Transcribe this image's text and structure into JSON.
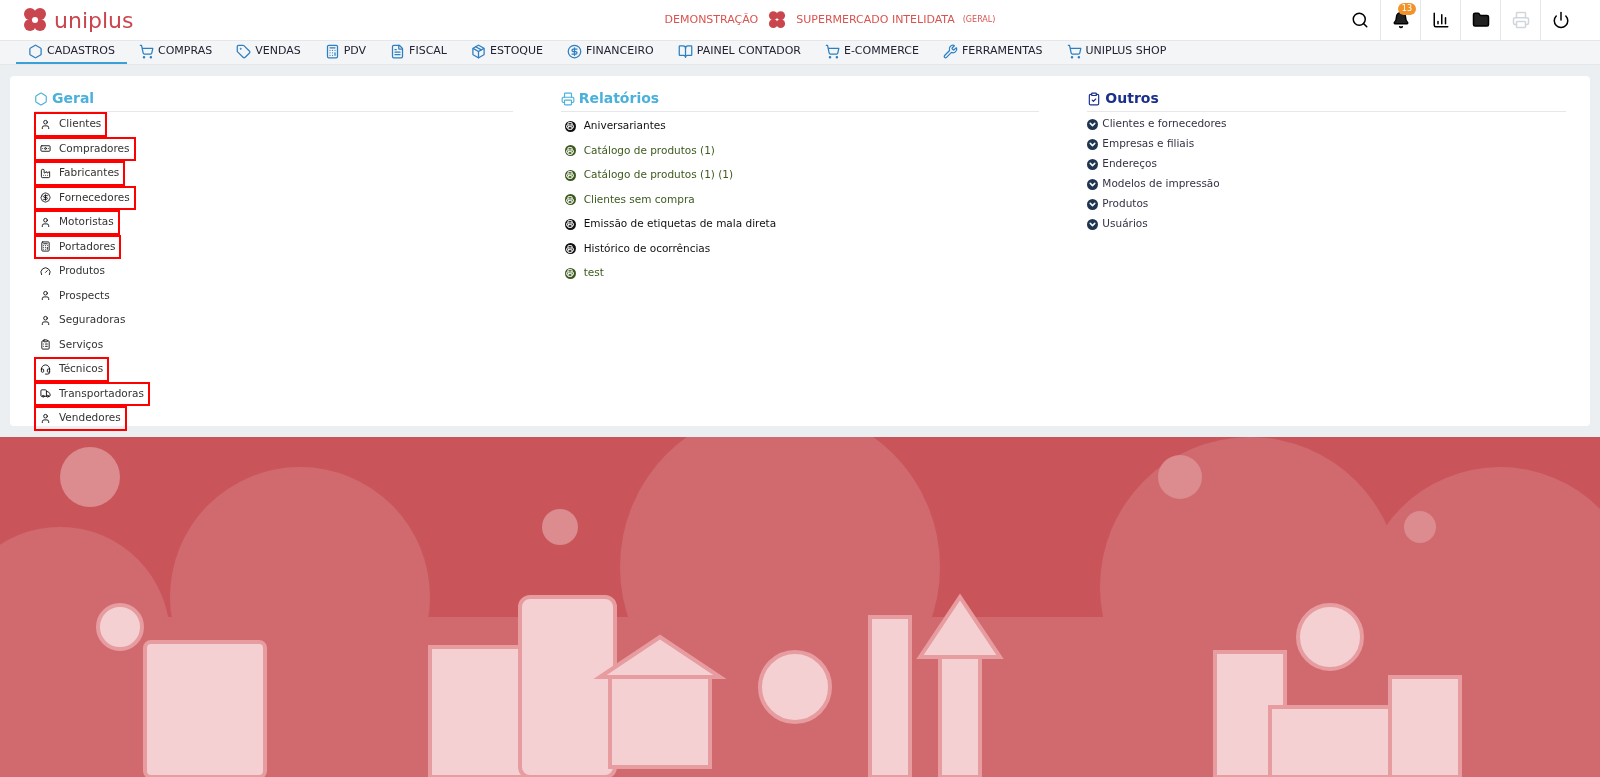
{
  "header": {
    "logo": "uniplus",
    "mode": "DEMONSTRAÇÃO",
    "company": "SUPERMERCADO INTELIDATA",
    "company_scope": "(GERAL)",
    "notifications": "13",
    "print_disabled": true
  },
  "nav": [
    {
      "label": "CADASTROS",
      "selected": true,
      "kind": "hexagon"
    },
    {
      "label": "COMPRAS",
      "selected": false,
      "kind": "cart"
    },
    {
      "label": "VENDAS",
      "selected": false,
      "kind": "tag"
    },
    {
      "label": "PDV",
      "selected": false,
      "kind": "register"
    },
    {
      "label": "FISCAL",
      "selected": false,
      "kind": "file"
    },
    {
      "label": "ESTOQUE",
      "selected": false,
      "kind": "box"
    },
    {
      "label": "FINANCEIRO",
      "selected": false,
      "kind": "dollar"
    },
    {
      "label": "PAINEL CONTADOR",
      "selected": false,
      "kind": "book"
    },
    {
      "label": "E-COMMERCE",
      "selected": false,
      "kind": "cart"
    },
    {
      "label": "FERRAMENTAS",
      "selected": false,
      "kind": "tools"
    },
    {
      "label": "UNIPLUS SHOP",
      "selected": false,
      "kind": "cart"
    }
  ],
  "geral": {
    "title": "Geral",
    "items": [
      {
        "label": "Clientes",
        "kind": "person",
        "highlighted": true
      },
      {
        "label": "Compradores",
        "kind": "cash",
        "highlighted": true
      },
      {
        "label": "Fabricantes",
        "kind": "factory",
        "highlighted": true
      },
      {
        "label": "Fornecedores",
        "kind": "dollar",
        "highlighted": true
      },
      {
        "label": "Motoristas",
        "kind": "person",
        "highlighted": true
      },
      {
        "label": "Portadores",
        "kind": "calculator",
        "highlighted": true
      },
      {
        "label": "Produtos",
        "kind": "gauge",
        "highlighted": false
      },
      {
        "label": "Prospects",
        "kind": "person",
        "highlighted": false
      },
      {
        "label": "Seguradoras",
        "kind": "person",
        "highlighted": false
      },
      {
        "label": "Serviços",
        "kind": "clipboard",
        "highlighted": false
      },
      {
        "label": "Técnicos",
        "kind": "headset",
        "highlighted": true
      },
      {
        "label": "Transportadoras",
        "kind": "truck",
        "highlighted": true
      },
      {
        "label": "Vendedores",
        "kind": "person",
        "highlighted": true
      }
    ]
  },
  "relatorios": {
    "title": "Relatórios",
    "items": [
      {
        "label": "Aniversariantes",
        "color": "#111111"
      },
      {
        "label": "Catálogo de produtos (1)",
        "color": "#3d5a1e"
      },
      {
        "label": "Catálogo de produtos (1) (1)",
        "color": "#3d5a1e"
      },
      {
        "label": "Clientes sem compra",
        "color": "#3d5a1e"
      },
      {
        "label": "Emissão de etiquetas de mala direta",
        "color": "#111111"
      },
      {
        "label": "Histórico de ocorrências",
        "color": "#111111"
      },
      {
        "label": "test",
        "color": "#3d5a1e"
      }
    ]
  },
  "outros": {
    "title": "Outros",
    "items": [
      "Clientes e fornecedores",
      "Empresas e filiais",
      "Endereços",
      "Modelos de impressão",
      "Produtos",
      "Usuários"
    ]
  }
}
